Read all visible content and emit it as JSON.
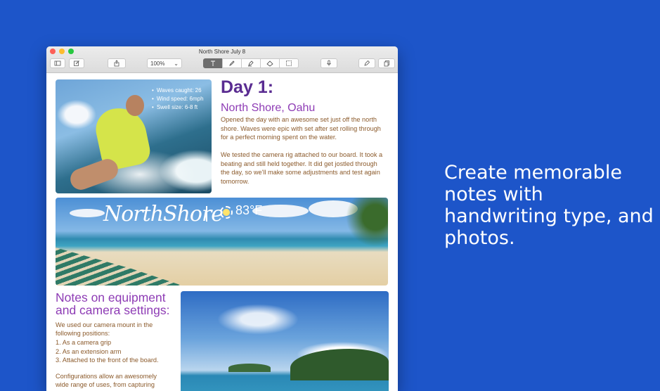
{
  "tagline": "Create memorable notes with handwriting type, and photos.",
  "window": {
    "title": "North Shore July 8",
    "zoom": "100%"
  },
  "toolbar": {
    "icons": [
      "sidebar-icon",
      "compose-icon",
      "share-icon",
      "text-tool-icon",
      "pencil-icon",
      "highlighter-icon",
      "eraser-icon",
      "selection-icon",
      "microphone-icon",
      "pen-icon",
      "pages-icon"
    ]
  },
  "note": {
    "photo1_stats": [
      "Waves caught: 26",
      "Wind speed: 6mph",
      "Swell size: 6-8 ft"
    ],
    "day_title": "Day 1:",
    "location": "North Shore, Oahu",
    "para1": "Opened the day with an awesome set just off the north shore. Waves were epic with set after set rolling through for a perfect morning spent on the water.",
    "para2": "We tested the camera rig attached to our board. It took a beating and still held together. It did get jostled through the day, so we'll make some adjustments and test again tomorrow.",
    "banner_handwriting": "NorthShore",
    "banner_temp": "83°F",
    "notes_title": "Notes on equipment and camera settings:",
    "notes_intro": "We used our camera mount in the following positions:",
    "notes_list": [
      "1. As a camera grip",
      "2. As an extension arm",
      "3. Attached to the front of the board."
    ],
    "notes_more": "Configurations allow an awesomely wide range of uses, from capturing"
  },
  "colors": {
    "background": "#1d55c9",
    "heading_purple": "#5a2c91",
    "subheading_purple": "#8e3cb5",
    "body_brown": "#8b5a2b"
  }
}
